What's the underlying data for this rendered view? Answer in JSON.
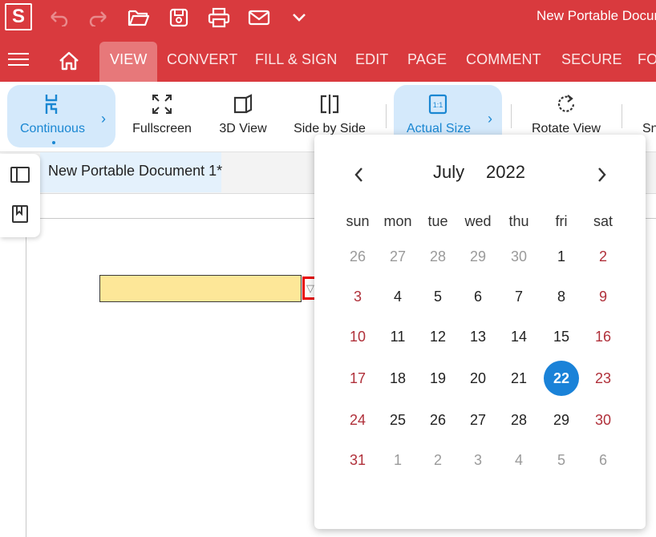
{
  "app": {
    "logo_letter": "S",
    "document_title": "New Portable Document 1"
  },
  "quick_access": [
    "undo-icon",
    "redo-icon",
    "open-folder-icon",
    "save-icon",
    "print-icon",
    "email-icon",
    "chevron-down-icon"
  ],
  "menu": {
    "tabs": [
      {
        "label": "VIEW",
        "active": true
      },
      {
        "label": "CONVERT"
      },
      {
        "label": "FILL & SIGN"
      },
      {
        "label": "EDIT"
      },
      {
        "label": "PAGE"
      },
      {
        "label": "COMMENT"
      },
      {
        "label": "SECURE"
      },
      {
        "label": "FO"
      }
    ]
  },
  "toolbar": {
    "tools": [
      {
        "label": "Continuous",
        "icon": "continuous-icon",
        "selected": true
      },
      {
        "label": "Fullscreen",
        "icon": "fullscreen-icon"
      },
      {
        "label": "3D View",
        "icon": "3d-view-icon"
      },
      {
        "label": "Side by Side",
        "icon": "side-by-side-icon"
      },
      {
        "label": "Actual Size",
        "icon": "actual-size-icon",
        "selected": true
      },
      {
        "label": "Rotate View",
        "icon": "rotate-icon"
      },
      {
        "label": "Sn",
        "icon": "snapshot-icon"
      }
    ],
    "actual_size_glyph": "1:1"
  },
  "document_tab": {
    "label": "New Portable Document 1*"
  },
  "date_field": {
    "dropdown_glyph": "▽"
  },
  "calendar": {
    "month": "July",
    "year": "2022",
    "weekdays": [
      "sun",
      "mon",
      "tue",
      "wed",
      "thu",
      "fri",
      "sat"
    ],
    "weeks": [
      [
        "26",
        "27",
        "28",
        "29",
        "30",
        "1",
        "2"
      ],
      [
        "3",
        "4",
        "5",
        "6",
        "7",
        "8",
        "9"
      ],
      [
        "10",
        "11",
        "12",
        "13",
        "14",
        "15",
        "16"
      ],
      [
        "17",
        "18",
        "19",
        "20",
        "21",
        "22",
        "23"
      ],
      [
        "24",
        "25",
        "26",
        "27",
        "28",
        "29",
        "30"
      ],
      [
        "31",
        "1",
        "2",
        "3",
        "4",
        "5",
        "6"
      ]
    ],
    "selected_day": "22",
    "selected_color": "#1a82d8",
    "weekend_color": "#b0303a"
  },
  "colors": {
    "brand": "#d93a3e",
    "accent": "#1a87d2",
    "field_fill": "#fde798"
  }
}
